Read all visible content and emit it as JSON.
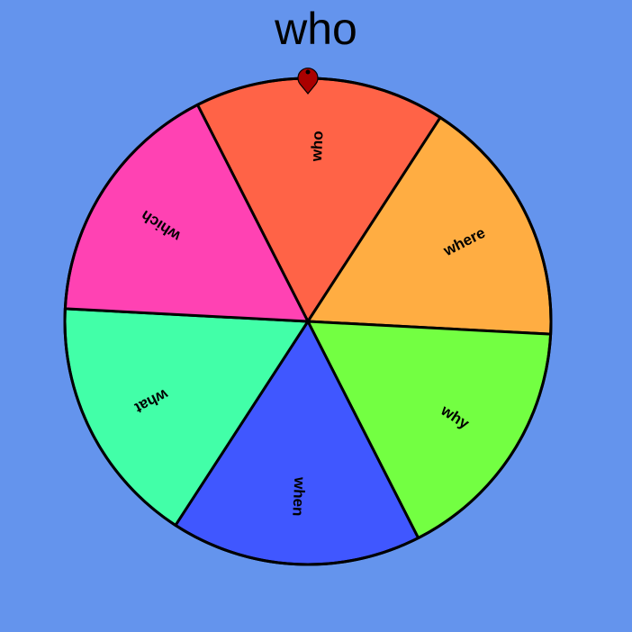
{
  "title": "who",
  "wheel": {
    "segments": [
      {
        "label": "who",
        "color": "#ff6347"
      },
      {
        "label": "where",
        "color": "#ffad42"
      },
      {
        "label": "why",
        "color": "#73ff42"
      },
      {
        "label": "when",
        "color": "#4057ff"
      },
      {
        "label": "what",
        "color": "#42ffa8"
      },
      {
        "label": "which",
        "color": "#ff42b3"
      }
    ],
    "pointer_color": "#aa0000",
    "outline_color": "#000000"
  }
}
